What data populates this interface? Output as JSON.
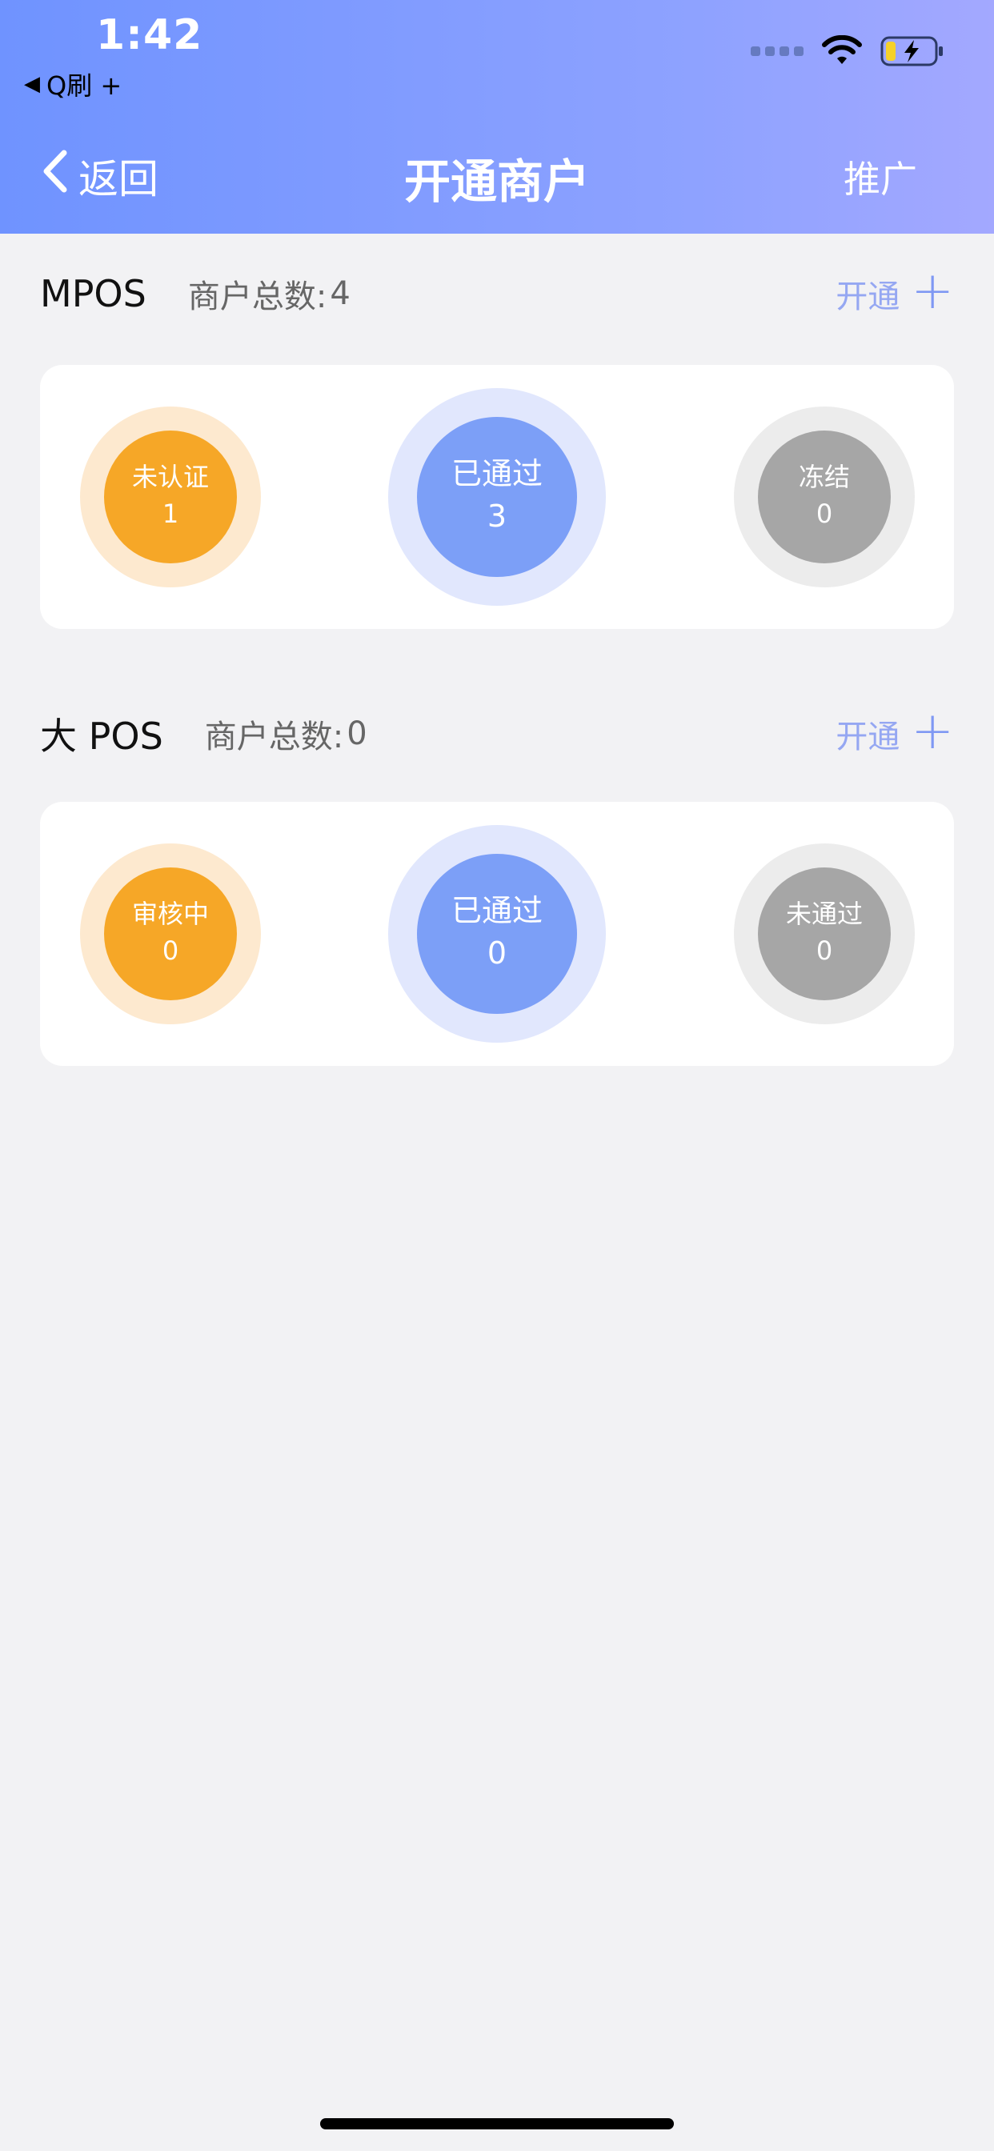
{
  "status_bar": {
    "time": "1:42",
    "back_app_label": "Q刷 +"
  },
  "nav": {
    "back_label": "返回",
    "title": "开通商户",
    "promote_label": "推广"
  },
  "colors": {
    "header_gradient_start": "#6f93ff",
    "header_gradient_end": "#a3a8ff",
    "orange": "#f6a727",
    "blue": "#7c9ff7",
    "gray": "#a6a6a6",
    "open_link": "#95a7f2"
  },
  "sections": [
    {
      "name": "MPOS",
      "count_label": "商户总数:",
      "count_value": "4",
      "open_label": "开通",
      "open_icon": "plus-icon",
      "statuses": [
        {
          "label": "未认证",
          "value": "1"
        },
        {
          "label": "已通过",
          "value": "3"
        },
        {
          "label": "冻结",
          "value": "0"
        }
      ]
    },
    {
      "name": "大 POS",
      "count_label": "商户总数:",
      "count_value": "0",
      "open_label": "开通",
      "open_icon": "plus-icon",
      "statuses": [
        {
          "label": "审核中",
          "value": "0"
        },
        {
          "label": "已通过",
          "value": "0"
        },
        {
          "label": "未通过",
          "value": "0"
        }
      ]
    }
  ]
}
